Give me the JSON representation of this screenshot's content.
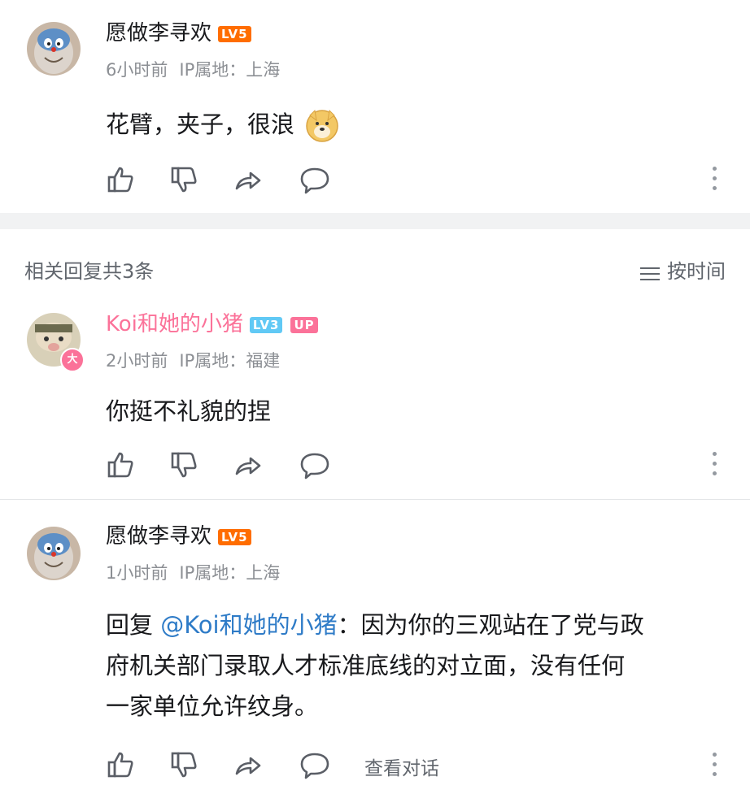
{
  "top_comment": {
    "username": "愿做李寻欢",
    "level": "LV5",
    "time": "6小时前",
    "ip": "IP属地：上海",
    "text": "花臂，夹子，很浪"
  },
  "replies_header": {
    "count_text": "相关回复共3条",
    "sort_label": "按时间"
  },
  "replies": [
    {
      "username": "Koi和她的小猪",
      "level": "LV3",
      "badge": "UP",
      "time": "2小时前",
      "ip": "IP属地：福建",
      "text": "你挺不礼貌的捏"
    },
    {
      "username": "愿做李寻欢",
      "level": "LV5",
      "time": "1小时前",
      "ip": "IP属地：上海",
      "reply_prefix": "回复 ",
      "mention": "@Koi和她的小猪",
      "text_line1": "：因为你的三观站在了党与政",
      "text_line2": "府机关部门录取人才标准底线的对立面，没有任何",
      "text_line3": "一家单位允许纹身。",
      "view_conversation": "查看对话"
    }
  ],
  "colors": {
    "level5": "#ff6d00",
    "level3": "#61c9f5",
    "up_badge": "#fb7299",
    "vip_name": "#fb7299",
    "mention": "#2e7bc7",
    "secondary_text": "#8c8f94"
  }
}
